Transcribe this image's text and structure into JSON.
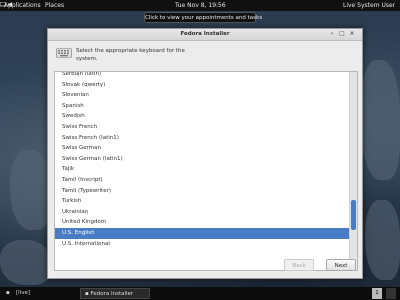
{
  "topbar": {
    "applications": "Applications",
    "places": "Places",
    "clock": "Tue Nov  8, 19:56",
    "user": "Live System User"
  },
  "tooltip": "Click to view your appointments and tasks",
  "window": {
    "title": "Fedora Installer",
    "prompt": "Select the appropriate keyboard for the system.",
    "items": [
      "Serbian (latin)",
      "Slovak (qwerty)",
      "Slovenian",
      "Spanish",
      "Swedish",
      "Swiss French",
      "Swiss French (latin1)",
      "Swiss German",
      "Swiss German (latin1)",
      "Tajik",
      "Tamil (Inscript)",
      "Tamil (Typewriter)",
      "Turkish",
      "Ukrainian",
      "United Kingdom",
      "U.S. English",
      "U.S. International"
    ],
    "selected": "U.S. English",
    "back_label": "Back",
    "next_label": "Next"
  },
  "bottombar": {
    "task1": "[live]",
    "task2": "Fedora Installer",
    "pager": "1"
  }
}
